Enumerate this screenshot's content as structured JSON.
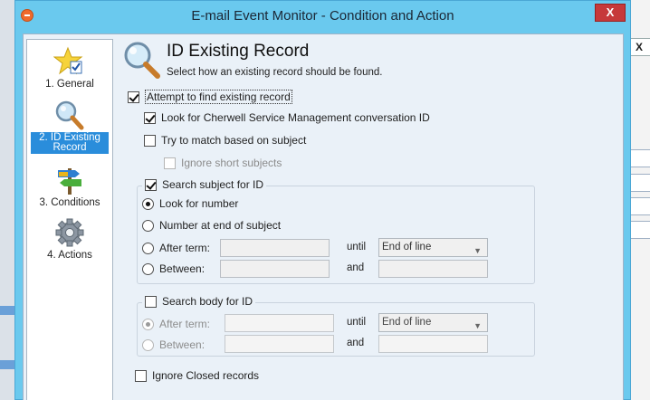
{
  "window": {
    "title": "E-mail Event Monitor - Condition and Action",
    "close_label": "X"
  },
  "background": {
    "close_label": "X"
  },
  "nav": {
    "items": [
      {
        "label": "1. General",
        "icon": "star-checklist-icon"
      },
      {
        "label": "2. ID Existing Record",
        "icon": "magnifier-icon"
      },
      {
        "label": "3. Conditions",
        "icon": "signpost-icon"
      },
      {
        "label": "4. Actions",
        "icon": "gear-icon"
      }
    ]
  },
  "header": {
    "title": "ID Existing Record",
    "subtitle": "Select how an existing record should be found."
  },
  "options": {
    "attempt_find": {
      "label": "Attempt to find existing record",
      "checked": true
    },
    "look_conversation_id": {
      "label": "Look for Cherwell Service Management conversation ID",
      "checked": true
    },
    "match_subject": {
      "label": "Try to match based on subject",
      "checked": false
    },
    "ignore_short": {
      "label": "Ignore short subjects",
      "checked": false
    }
  },
  "subject_group": {
    "legend": "Search subject for ID",
    "checked": true,
    "look_for_number": "Look for number",
    "number_at_end": "Number at end of subject",
    "after_term": "After term:",
    "between": "Between:",
    "until": "until",
    "and": "and",
    "until_value": "End of line"
  },
  "body_group": {
    "legend": "Search body for ID",
    "checked": false,
    "after_term": "After term:",
    "between": "Between:",
    "until": "until",
    "and": "and",
    "until_value": "End of line"
  },
  "ignore_closed": {
    "label": "Ignore Closed records",
    "checked": false
  }
}
